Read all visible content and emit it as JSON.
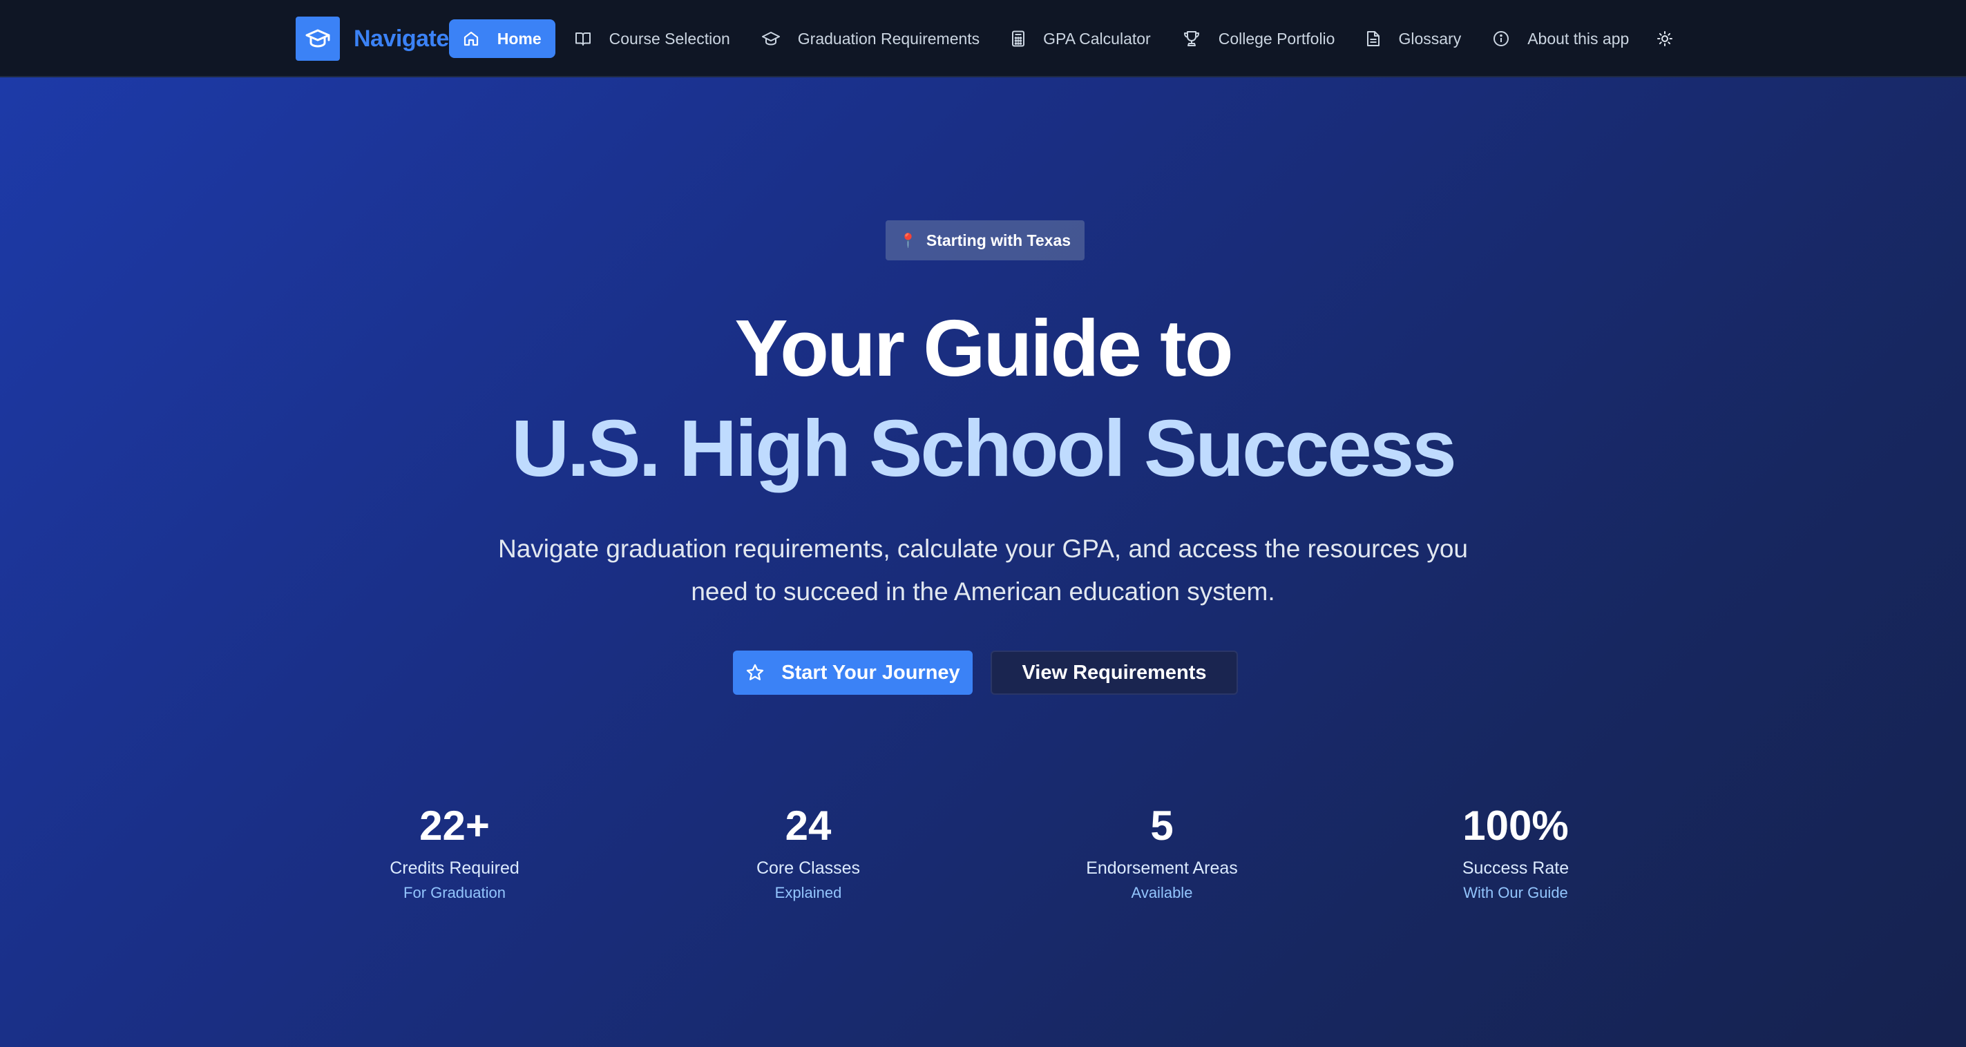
{
  "header": {
    "brand": "Navigate",
    "nav": [
      {
        "label": "Home",
        "icon": "home-icon",
        "active": true
      },
      {
        "label": "Course Selection",
        "icon": "book-icon"
      },
      {
        "label": "Graduation Requirements",
        "icon": "graduation-cap-icon"
      },
      {
        "label": "GPA Calculator",
        "icon": "calculator-icon"
      },
      {
        "label": "College Portfolio",
        "icon": "trophy-icon"
      },
      {
        "label": "Glossary",
        "icon": "document-icon"
      },
      {
        "label": "About this app",
        "icon": "info-icon"
      }
    ],
    "theme_toggle_icon": "sun-icon"
  },
  "hero": {
    "badge": "Starting with Texas",
    "badge_icon": "pin-icon",
    "title_line1": "Your Guide to",
    "title_line2": "U.S. High School Success",
    "subtitle": "Navigate graduation requirements, calculate your GPA, and access the resources you need to succeed in the American education system.",
    "primary_button": "Start Your Journey",
    "primary_button_icon": "star-icon",
    "secondary_button": "View Requirements"
  },
  "stats": [
    {
      "value": "22+",
      "label": "Credits Required",
      "sub": "For Graduation"
    },
    {
      "value": "24",
      "label": "Core Classes",
      "sub": "Explained"
    },
    {
      "value": "5",
      "label": "Endorsement Areas",
      "sub": "Available"
    },
    {
      "value": "100%",
      "label": "Success Rate",
      "sub": "With Our Guide"
    }
  ],
  "colors": {
    "accent": "#3b82f6",
    "navbar_bg": "#0f1625",
    "hero_start": "#1d3aa8",
    "hero_end": "#16224f",
    "title_highlight": "#bfdbfe"
  }
}
